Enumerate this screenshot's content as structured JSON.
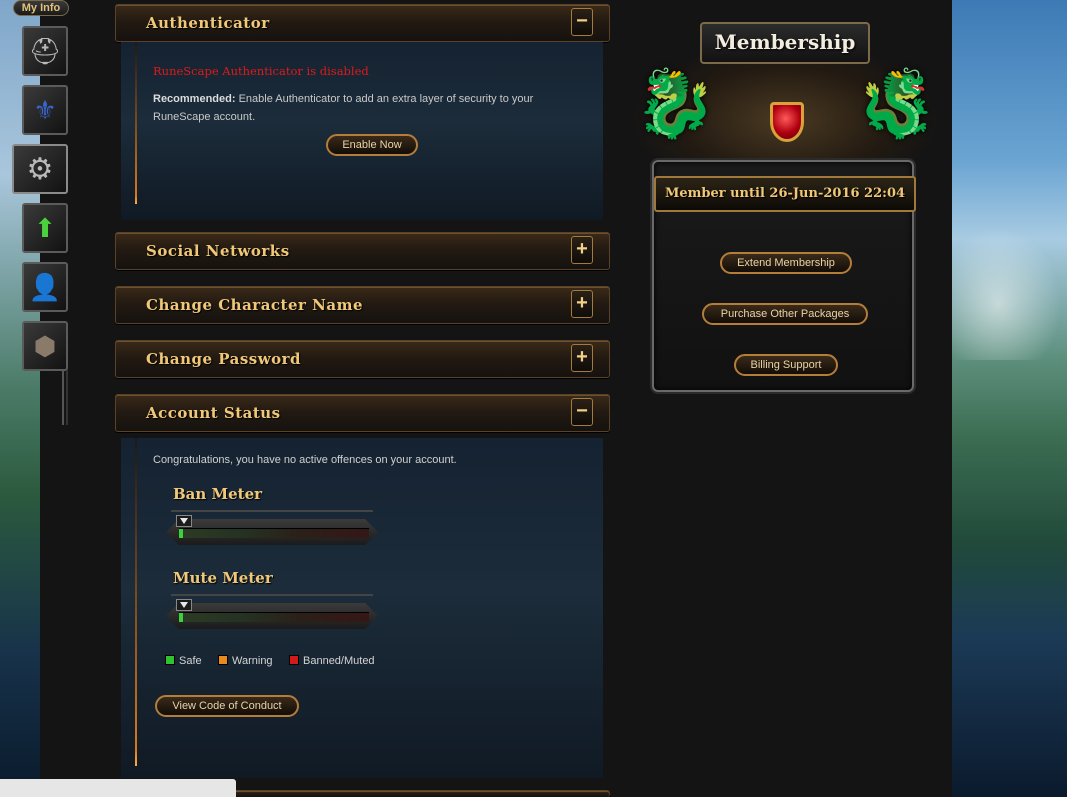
{
  "nav": {
    "tab_label": "My Info",
    "items": [
      {
        "icon": "helmet-icon",
        "glyph": "⛑"
      },
      {
        "icon": "banner-icon",
        "glyph": "⚜"
      },
      {
        "icon": "gear-icon",
        "glyph": "⚙"
      },
      {
        "icon": "upgrade-arrow-icon",
        "glyph": "⬆"
      },
      {
        "icon": "add-friend-icon",
        "glyph": "👤"
      },
      {
        "icon": "orb-icon",
        "glyph": "⬢"
      }
    ]
  },
  "authenticator": {
    "title": "Authenticator",
    "toggle": "−",
    "status": "RuneScape Authenticator is disabled",
    "recommended_label": "Recommended:",
    "recommended_text": " Enable Authenticator to add an extra layer of security to your RuneScape account.",
    "enable_button": "Enable Now"
  },
  "sections": {
    "social": {
      "title": "Social Networks",
      "toggle": "+"
    },
    "change_name": {
      "title": "Change Character Name",
      "toggle": "+"
    },
    "change_password": {
      "title": "Change Password",
      "toggle": "+"
    }
  },
  "account_status": {
    "title": "Account Status",
    "toggle": "−",
    "message": "Congratulations, you have no active offences on your account.",
    "ban_meter": {
      "title": "Ban Meter",
      "level": 0
    },
    "mute_meter": {
      "title": "Mute Meter",
      "level": 0
    },
    "legend": [
      {
        "label": "Safe",
        "color": "#2fc42f"
      },
      {
        "label": "Warning",
        "color": "#e98a1f"
      },
      {
        "label": "Banned/Muted",
        "color": "#d11a1a"
      }
    ],
    "conduct_button": "View Code of Conduct"
  },
  "membership": {
    "title": "Membership",
    "member_until": "Member until 26-Jun-2016 22:04",
    "buttons": {
      "extend": "Extend Membership",
      "purchase": "Purchase Other Packages",
      "billing": "Billing Support"
    }
  },
  "colors": {
    "accent_gold": "#f0c878",
    "alert_red": "#e01a1a",
    "button_border": "#b47d39"
  }
}
